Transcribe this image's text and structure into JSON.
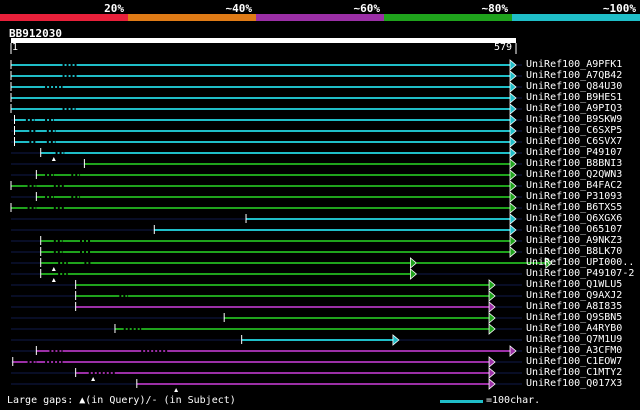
{
  "color_scale": {
    "segments": [
      {
        "label": "20%",
        "color": "#e8203a"
      },
      {
        "label": "~40%",
        "color": "#e07b16"
      },
      {
        "label": "~60%",
        "color": "#9b2fa6"
      },
      {
        "label": "~80%",
        "color": "#1fa31c"
      },
      {
        "label": "~100%",
        "color": "#1fbec8"
      }
    ]
  },
  "query": {
    "name": "BB912030",
    "start_label": "1",
    "end_label": "579",
    "length": 579
  },
  "hits": [
    {
      "label": "UniRef100_A9PFK1",
      "color": "#1fbec8",
      "start": 1,
      "end": 579,
      "gaps": [
        [
          60,
          78
        ]
      ]
    },
    {
      "label": "UniRef100_A7QB42",
      "color": "#1fbec8",
      "start": 1,
      "end": 579,
      "gaps": [
        [
          60,
          78
        ]
      ]
    },
    {
      "label": "UniRef100_Q84U30",
      "color": "#1fbec8",
      "start": 1,
      "end": 579,
      "gaps": [
        [
          40,
          60
        ]
      ]
    },
    {
      "label": "UniRef100_B9HES1",
      "color": "#1fbec8",
      "start": 1,
      "end": 579,
      "gaps": []
    },
    {
      "label": "UniRef100_A9PIQ3",
      "color": "#1fbec8",
      "start": 1,
      "end": 579,
      "gaps": [
        [
          60,
          75
        ]
      ]
    },
    {
      "label": "UniRef100_B9SKW9",
      "color": "#1fbec8",
      "start": 5,
      "end": 579,
      "gaps": [
        [
          18,
          28
        ],
        [
          40,
          50
        ]
      ]
    },
    {
      "label": "UniRef100_C6SXP5",
      "color": "#1fbec8",
      "start": 5,
      "end": 579,
      "gaps": [
        [
          22,
          30
        ],
        [
          42,
          52
        ]
      ]
    },
    {
      "label": "UniRef100_C6SVX7",
      "color": "#1fbec8",
      "start": 5,
      "end": 579,
      "gaps": [
        [
          22,
          30
        ],
        [
          42,
          52
        ]
      ]
    },
    {
      "label": "UniRef100_P49107",
      "color": "#1fbec8",
      "start": 35,
      "end": 579,
      "gaps": [
        [
          52,
          62
        ]
      ],
      "marker": 50
    },
    {
      "label": "UniRef100_B8BNI3",
      "color": "#1fa31c",
      "start": 85,
      "end": 579,
      "gaps": []
    },
    {
      "label": "UniRef100_Q2QWN3",
      "color": "#1fa31c",
      "start": 30,
      "end": 579,
      "gaps": [
        [
          40,
          50
        ],
        [
          70,
          80
        ]
      ]
    },
    {
      "label": "UniRef100_B4FAC2",
      "color": "#1fa31c",
      "start": 1,
      "end": 579,
      "gaps": [
        [
          20,
          30
        ],
        [
          50,
          62
        ]
      ]
    },
    {
      "label": "UniRef100_P31093",
      "color": "#1fa31c",
      "start": 30,
      "end": 579,
      "gaps": [
        [
          40,
          50
        ],
        [
          70,
          80
        ]
      ]
    },
    {
      "label": "UniRef100_B6TXS5",
      "color": "#1fa31c",
      "start": 1,
      "end": 579,
      "gaps": [
        [
          20,
          30
        ],
        [
          50,
          62
        ]
      ]
    },
    {
      "label": "UniRef100_Q6XGX6",
      "color": "#1fbec8",
      "start": 270,
      "end": 579,
      "gaps": []
    },
    {
      "label": "UniRef100_O65107",
      "color": "#1fbec8",
      "start": 165,
      "end": 579,
      "gaps": []
    },
    {
      "label": "UniRef100_A9NKZ3",
      "color": "#1fa31c",
      "start": 35,
      "end": 579,
      "gaps": [
        [
          50,
          60
        ],
        [
          80,
          92
        ]
      ]
    },
    {
      "label": "UniRef100_B8LK70",
      "color": "#1fa31c",
      "start": 35,
      "end": 579,
      "gaps": [
        [
          50,
          60
        ],
        [
          80,
          92
        ]
      ]
    },
    {
      "label": "UniRef100_UPI000..",
      "color": "#1fa31c",
      "start": 35,
      "end": 620,
      "gaps": [
        [
          55,
          66
        ],
        [
          85,
          92
        ]
      ],
      "marker": 50,
      "mid_end": 465
    },
    {
      "label": "UniRef100_P49107-2",
      "color": "#1fa31c",
      "start": 35,
      "end": 465,
      "gaps": [
        [
          55,
          66
        ]
      ],
      "marker": 50
    },
    {
      "label": "UniRef100_Q1WLU5",
      "color": "#1fa31c",
      "start": 75,
      "end": 555,
      "gaps": []
    },
    {
      "label": "UniRef100_Q9AXJ2",
      "color": "#1fa31c",
      "start": 75,
      "end": 555,
      "gaps": [
        [
          125,
          135
        ]
      ]
    },
    {
      "label": "UniRef100_A8I835",
      "color": "#9b2fa6",
      "start": 75,
      "end": 555,
      "gaps": []
    },
    {
      "label": "UniRef100_Q9SBN5",
      "color": "#1fa31c",
      "start": 245,
      "end": 555,
      "gaps": []
    },
    {
      "label": "UniRef100_A4RYB0",
      "color": "#1fa31c",
      "start": 120,
      "end": 555,
      "gaps": [
        [
          130,
          150
        ]
      ]
    },
    {
      "label": "UniRef100_Q7M1U9",
      "color": "#1fbec8",
      "start": 265,
      "end": 445,
      "gaps": []
    },
    {
      "label": "UniRef100_A3CFM0",
      "color": "#9b2fa6",
      "start": 30,
      "end": 579,
      "gaps": [
        [
          45,
          60
        ],
        [
          150,
          180
        ]
      ]
    },
    {
      "label": "UniRef100_C1EOW7",
      "color": "#9b2fa6",
      "start": 3,
      "end": 555,
      "gaps": [
        [
          20,
          30
        ],
        [
          40,
          60
        ]
      ]
    },
    {
      "label": "UniRef100_C1MTY2",
      "color": "#9b2fa6",
      "start": 75,
      "end": 555,
      "gaps": [
        [
          90,
          120
        ]
      ],
      "marker": 95
    },
    {
      "label": "UniRef100_Q017X3",
      "color": "#9b2fa6",
      "start": 145,
      "end": 555,
      "gaps": [],
      "marker": 190
    }
  ],
  "footer": {
    "large_gaps_text": "Large gaps: ▲(in Query)/- (in Subject)",
    "scale_text": "=100char.",
    "scale_color": "#1fbec8"
  }
}
